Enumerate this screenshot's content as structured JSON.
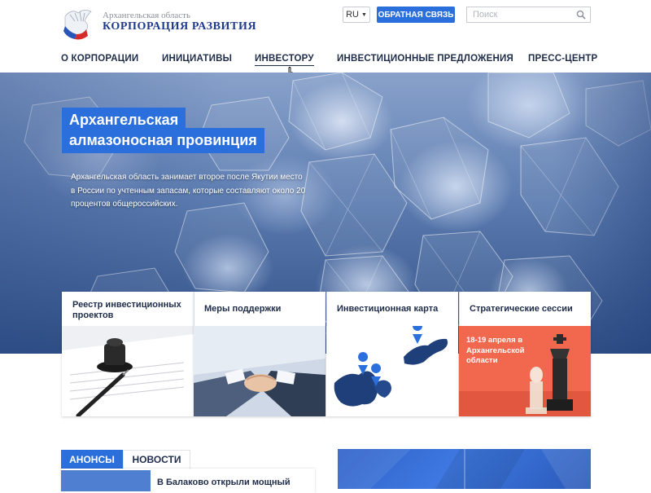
{
  "header": {
    "logo_subtitle": "Архангельская область",
    "logo_title": "КОРПОРАЦИЯ РАЗВИТИЯ",
    "lang": "RU",
    "feedback_label": "ОБРАТНАЯ СВЯЗЬ",
    "search_placeholder": "Поиск"
  },
  "nav": [
    {
      "label": "О КОРПОРАЦИИ"
    },
    {
      "label": "ИНИЦИАТИВЫ"
    },
    {
      "label": "ИНВЕСТОРУ",
      "active": true
    },
    {
      "label": "ИНВЕСТИЦИОННЫЕ ПРЕДЛОЖЕНИЯ"
    },
    {
      "label": "ПРЕСС-ЦЕНТР"
    }
  ],
  "hero": {
    "title_line1": "Архангельская",
    "title_line2": "алмазоносная провинция",
    "description": "Архангельская область занимает второе после Якутии место в России по учтенным запасам, которые составляют около 20 процентов общероссийских."
  },
  "cards": [
    {
      "title": "Реестр инвестиционных проектов",
      "image": "stamp-and-pen"
    },
    {
      "title": "Меры поддержки",
      "image": "handshake"
    },
    {
      "title": "Инвестиционная карта",
      "image": "region-map"
    },
    {
      "title": "Стратегические сессии",
      "image": "chess-pieces",
      "overlay_text": "18-19 апреля в Архангельской области"
    }
  ],
  "bottom": {
    "tab_anons": "АНОНСЫ",
    "tab_news": "НОВОСТИ",
    "news_headline": "В Балаково открыли мощный"
  },
  "colors": {
    "accent": "#2a6fdb",
    "nav_text": "#1f2d4a",
    "sessions_bg": "#f2684f"
  }
}
